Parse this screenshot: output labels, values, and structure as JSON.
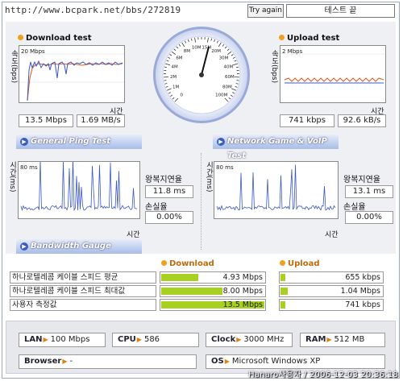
{
  "header": {
    "url": "http://www.bcpark.net/bbs/272819",
    "try_again": "Try again",
    "status": "테스트 끝"
  },
  "download": {
    "title": "Download test",
    "ylabel": "속도(bps)",
    "scale": "20 Mbps",
    "xlabel": "시간",
    "speed": "13.5 Mbps",
    "bytes": "1.69 MB/s"
  },
  "upload": {
    "title": "Upload test",
    "ylabel": "속도(bps)",
    "scale": "2 Mbps",
    "xlabel": "시간",
    "speed": "741 kbps",
    "bytes": "92.6 kB/s"
  },
  "tabs": {
    "ping": "General Ping Test",
    "game": "Network Game & VoIP Test",
    "gauge": "Bandwidth Gauge"
  },
  "ping_left": {
    "ylabel": "시간(ms)",
    "scale": "80 ms",
    "xlabel": "시간",
    "rtt_label": "왕복지연율",
    "rtt_value": "11.8 ms",
    "loss_label": "손실율",
    "loss_value": "0.00%"
  },
  "ping_right": {
    "ylabel": "시간(ms)",
    "scale": "80 ms",
    "xlabel": "시간",
    "rtt_label": "왕복지연율",
    "rtt_value": "13.1 ms",
    "loss_label": "손실율",
    "loss_value": "0.00%"
  },
  "gauge": {
    "download_title": "Download",
    "upload_title": "Upload",
    "rows": [
      {
        "label": "하나로텔레콤 케이블 스피드 평균",
        "down": "4.93 Mbps",
        "down_frac": 0.36,
        "up": "655 kbps",
        "up_frac": 0.05
      },
      {
        "label": "하나로텔레콤 케이블 스피드 최대값",
        "down": "8.00 Mbps",
        "down_frac": 0.59,
        "up": "1.04 Mbps",
        "up_frac": 0.07
      },
      {
        "label": "사용자 측정값",
        "down": "13.5 Mbps",
        "down_frac": 1.0,
        "up": "741 kbps",
        "up_frac": 0.05
      }
    ]
  },
  "sysinfo": {
    "lan_label": "LAN",
    "lan": "100 Mbps",
    "cpu_label": "CPU",
    "cpu": "586",
    "clock_label": "Clock",
    "clock": "3000 MHz",
    "ram_label": "RAM",
    "ram": "512 MB",
    "browser_label": "Browser",
    "browser": "-",
    "os_label": "OS",
    "os": "Microsoft Windows XP"
  },
  "dial_labels": [
    "0",
    "1M",
    "2M",
    "4M",
    "6M",
    "8M",
    "10M",
    "15M",
    "20M",
    "30M",
    "40M",
    "60M",
    "80M",
    "100M"
  ],
  "footer": "Hanaro사용자 / 2006-12-03 20:36:18"
}
